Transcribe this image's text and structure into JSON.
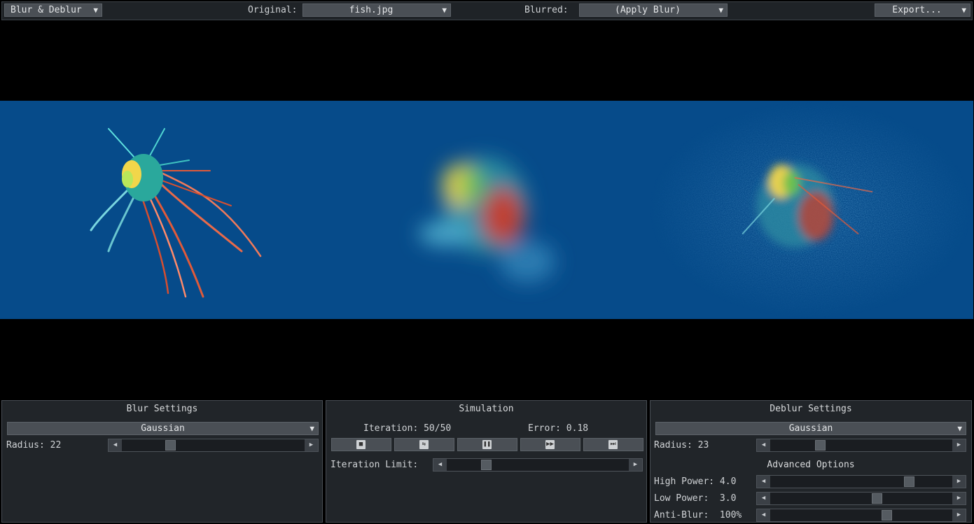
{
  "toolbar": {
    "app_menu": "Blur & Deblur",
    "original_label": "Original:",
    "original_value": "fish.jpg",
    "blurred_label": "Blurred:",
    "blurred_value": "(Apply Blur)",
    "export_label": "Export..."
  },
  "blur_settings": {
    "title": "Blur Settings",
    "kernel": "Gaussian",
    "radius_label": "Radius: 22",
    "radius_fraction": 0.25
  },
  "simulation": {
    "title": "Simulation",
    "iteration": "Iteration: 50/50",
    "error": "Error: 0.18",
    "buttons": [
      "stop-icon",
      "loop-icon",
      "pause-icon",
      "fast-forward-icon",
      "skip-to-end-icon"
    ],
    "iteration_limit_label": "Iteration Limit:",
    "iteration_limit_fraction": 0.2
  },
  "deblur_settings": {
    "title": "Deblur Settings",
    "kernel": "Gaussian",
    "radius_label": "Radius: 23",
    "radius_fraction": 0.26,
    "advanced_title": "Advanced Options",
    "high_power_label": "High Power: 4.0",
    "high_power_fraction": 0.78,
    "low_power_label": "Low Power:  3.0",
    "low_power_fraction": 0.59,
    "anti_blur_label": "Anti-Blur:  100%",
    "anti_blur_fraction": 0.65
  },
  "colors": {
    "water": "#064b8a",
    "panel_bg": "#212529"
  }
}
